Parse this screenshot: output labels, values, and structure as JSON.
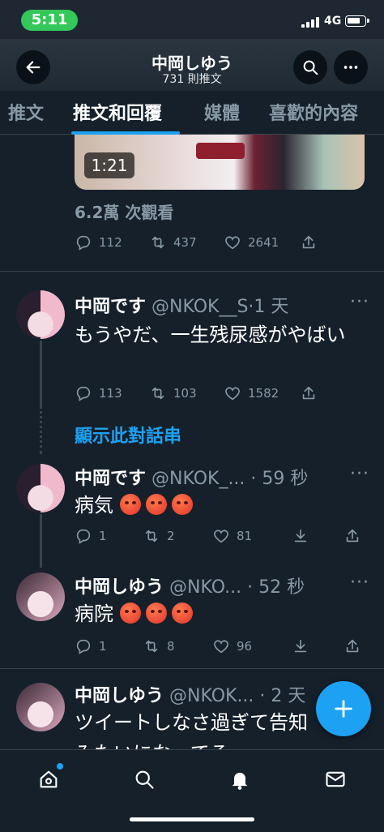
{
  "status_bar": {
    "time": "5:11",
    "network": "4G",
    "battery_level": 0.8
  },
  "header": {
    "title": "中岡しゆう",
    "subtitle": "731 則推文"
  },
  "tabs": [
    {
      "label": "推文",
      "active": false
    },
    {
      "label": "推文和回覆",
      "active": true
    },
    {
      "label": "媒體",
      "active": false
    },
    {
      "label": "喜歡的內容",
      "active": false
    }
  ],
  "media_tweet": {
    "duration": "1:21",
    "views": "6.2萬 次觀看",
    "actions": {
      "replies": "112",
      "retweets": "437",
      "likes": "2641"
    }
  },
  "tweets": [
    {
      "name": "中岡です",
      "handle": "@NKOK__S",
      "time": "·1 天",
      "text": "もうやだ、一生残尿感がやばい",
      "actions": {
        "replies": "113",
        "retweets": "103",
        "likes": "1582"
      }
    },
    {
      "name": "中岡です",
      "handle": "@NKOK_... ",
      "time": "· 59 秒",
      "text": "病気",
      "emoji": [
        "😡",
        "😡",
        "😡"
      ],
      "actions": {
        "replies": "1",
        "retweets": "2",
        "likes": "81"
      }
    },
    {
      "name": "中岡しゆう",
      "handle": "@NKO... ",
      "time": "· 52 秒",
      "text": "病院",
      "emoji": [
        "😡",
        "😡",
        "😡"
      ],
      "actions": {
        "replies": "1",
        "retweets": "8",
        "likes": "96"
      }
    },
    {
      "name": "中岡しゆう",
      "handle": "@NKOK... ",
      "time": "· 2 天",
      "text_line1": "ツイートしなさ過ぎて告知",
      "text_line2": "みたいになってる"
    }
  ],
  "show_thread": "顯示此對話串",
  "colors": {
    "accent": "#1da1f2",
    "background": "#15202b",
    "muted": "#8899a6"
  },
  "icons": [
    "back-arrow-icon",
    "search-icon",
    "more-icon",
    "reply-icon",
    "retweet-icon",
    "like-icon",
    "share-icon",
    "bookmark-icon",
    "compose-icon",
    "home-icon",
    "notifications-icon",
    "messages-icon"
  ]
}
